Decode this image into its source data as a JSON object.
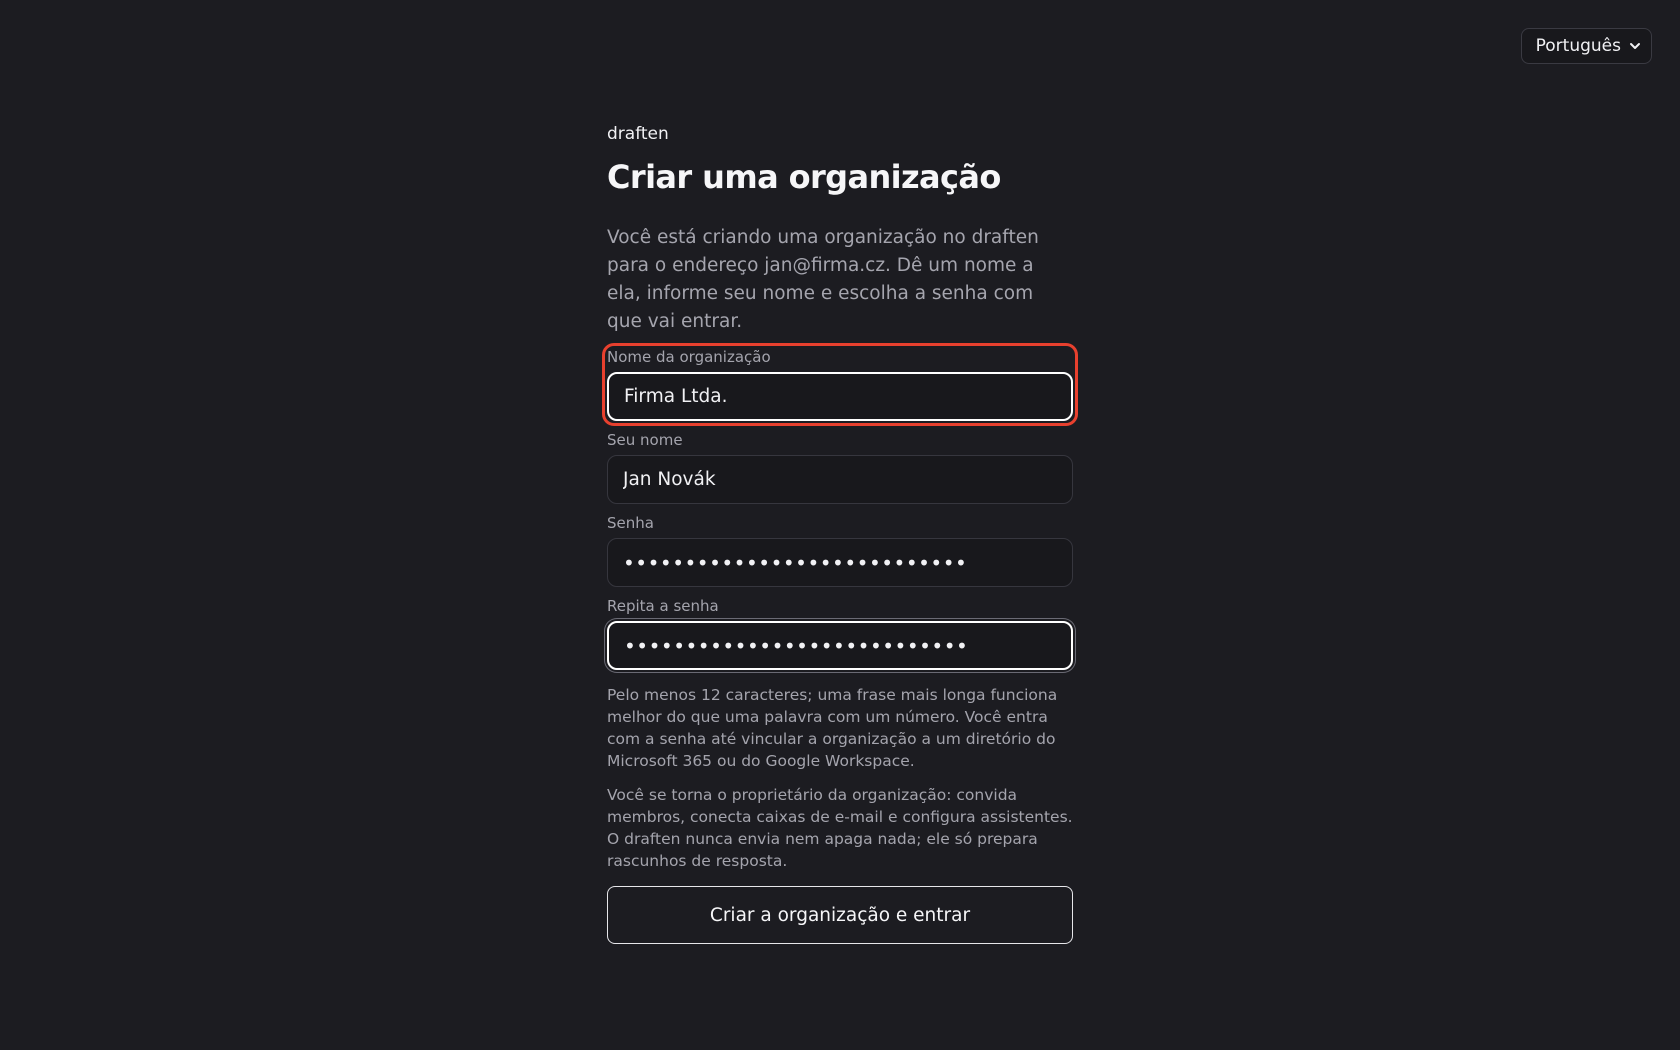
{
  "language": {
    "selected": "Português",
    "icon": "chevron-down-icon"
  },
  "brand": "draften",
  "title": "Criar uma organização",
  "intro": "Você está criando uma organização no draften para o endereço jan@firma.cz. Dê um nome a ela, informe seu nome e escolha a senha com que vai entrar.",
  "form": {
    "org_name": {
      "label": "Nome da organização",
      "value": "Firma Ltda."
    },
    "your_name": {
      "label": "Seu nome",
      "value": "Jan Novák"
    },
    "password": {
      "label": "Senha",
      "value": "••••••••••••••••••••••••••••"
    },
    "repeat_password": {
      "label": "Repita a senha",
      "value": "••••••••••••••••••••••••••••"
    }
  },
  "hints": {
    "password_hint": "Pelo menos 12 caracteres; uma frase mais longa funciona melhor do que uma palavra com um número. Você entra com a senha até vincular a organização a um diretório do Microsoft 365 ou do Google Workspace.",
    "owner_hint": "Você se torna o proprietário da organização: convida membros, conecta caixas de e-mail e configura assistentes. O draften nunca envia nem apaga nada; ele só prepara rascunhos de resposta."
  },
  "submit_label": "Criar a organização e entrar",
  "colors": {
    "background": "#1c1c21",
    "highlight": "#e8402e",
    "text_muted": "#a4a4ad"
  }
}
